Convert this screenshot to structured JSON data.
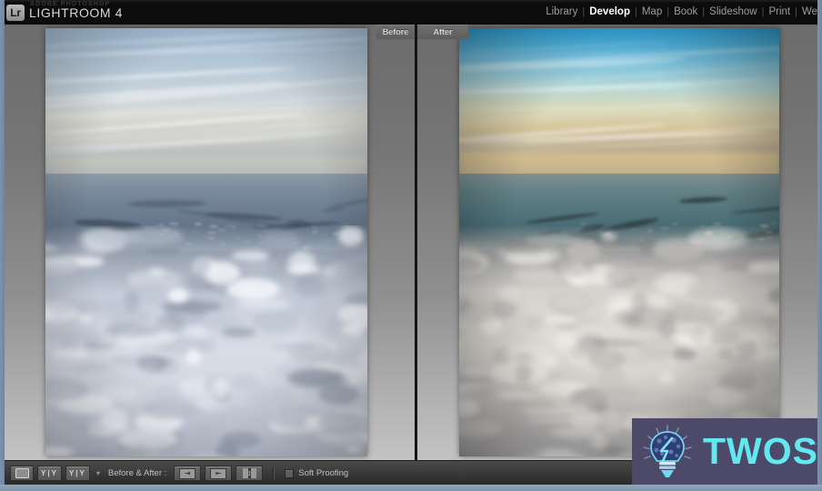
{
  "app": {
    "logo_badge": "Lr",
    "brand_overline": "ADOBE PHOTOSHOP",
    "brand_title": "LIGHTROOM 4"
  },
  "modules": {
    "separator": "|",
    "items": [
      {
        "label": "Library",
        "active": false
      },
      {
        "label": "Develop",
        "active": true
      },
      {
        "label": "Map",
        "active": false
      },
      {
        "label": "Book",
        "active": false
      },
      {
        "label": "Slideshow",
        "active": false
      },
      {
        "label": "Print",
        "active": false
      },
      {
        "label": "We",
        "active": false
      }
    ]
  },
  "compare": {
    "before_tab": "Before",
    "after_tab": "After"
  },
  "toolbar": {
    "loupe_view_icon": "loupe-view-icon",
    "compare_view_icon": "compare-view-icon",
    "compare_view_label": "Y|Y",
    "survey_view_label": "Y|Y",
    "view_menu_caret": "▾",
    "before_after_label": "Before & After :",
    "copy_after_to_before_label": "⇥",
    "copy_before_to_after_label": "⇤",
    "swap_label": "↕",
    "soft_proofing_label": "Soft Proofing",
    "soft_proofing_checked": false
  },
  "watermark": {
    "text": "TWOS",
    "icon": "lightbulb-icon",
    "background_color": "#4c4a68",
    "text_color": "#62e8ef"
  },
  "photos": {
    "before": {
      "caption": "Before",
      "description": "Aerial photograph of a coastal bay with city, hills and a dense cloud layer — unedited, hazy and desaturated"
    },
    "after": {
      "caption": "After",
      "description": "Same aerial photograph after Develop edits — deeper cyan sky, warmer golden horizon, increased contrast and saturation"
    }
  },
  "colors": {
    "window_chrome": "#7d93ad",
    "top_bar": "#0c0c0c",
    "panel_gray": "#8f8f8f",
    "toolbar": "#3e3e3e",
    "active_module": "#ffffff",
    "inactive_module": "#9d9d9d"
  }
}
